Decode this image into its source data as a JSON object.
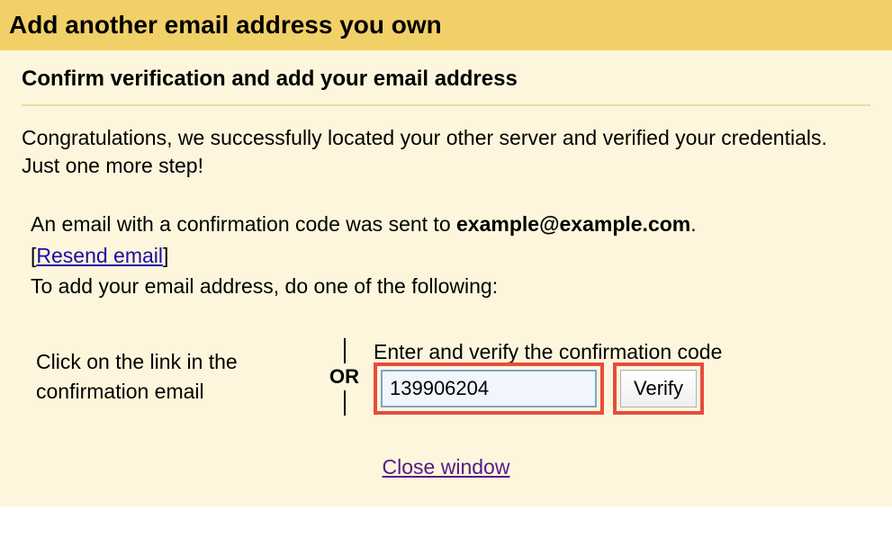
{
  "header": {
    "title": "Add another email address you own"
  },
  "subtitle": "Confirm verification and add your email address",
  "congrats": "Congratulations, we successfully located your other server and verified your credentials. Just one more step!",
  "instructions": {
    "line1_prefix": "An email with a confirmation code was sent to ",
    "email": "example@example.com",
    "line1_suffix": ".",
    "bracket_open": "[",
    "resend_label": "Resend email",
    "bracket_close": "]",
    "line2": "To add your email address, do one of the following:"
  },
  "options": {
    "left": "Click on the link in the confirmation email",
    "or_label": "OR",
    "right_label": "Enter and verify the confirmation code",
    "code_value": "139906204",
    "verify_label": "Verify"
  },
  "close_label": "Close window"
}
